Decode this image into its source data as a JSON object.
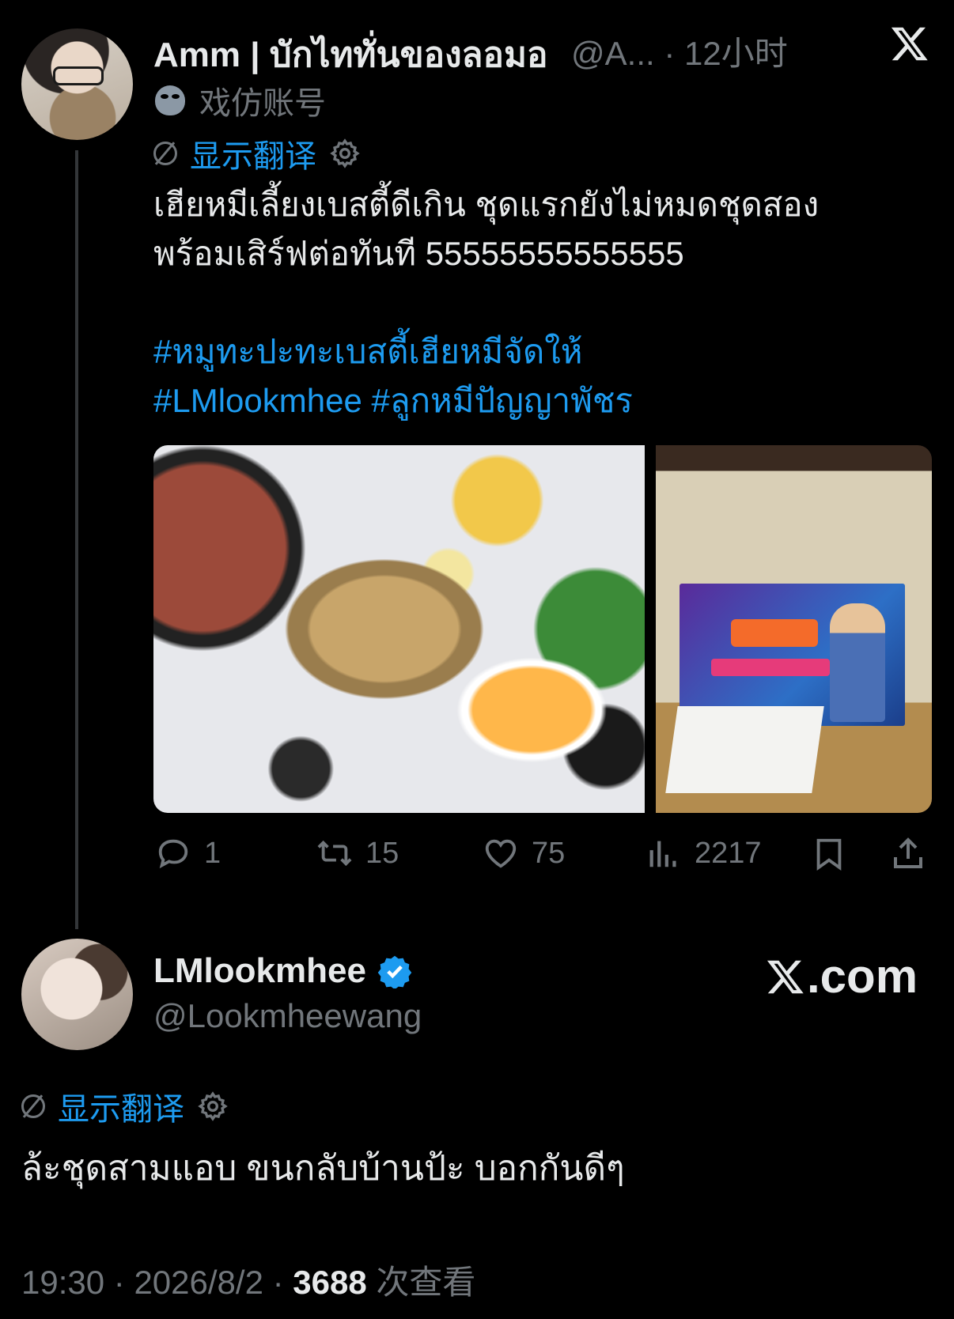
{
  "tweet": {
    "author_name": "Amm | บักไททั่นของลอมอ",
    "author_handle": "@A...",
    "separator": " · ",
    "time_ago": "12小时",
    "parody_label": "戏仿账号",
    "translate_label": "显示翻译",
    "text_line1": "เฮียหมีเลี้ยงเบสตี้ดีเกิน ชุดแรกยังไม่หมดชุดสอง",
    "text_line2": "พร้อมเสิร์ฟต่อทันที 55555555555555",
    "hashtag_line1": "#หมูทะปะทะเบสตี้เฮียหมีจัดให้",
    "hashtag_line2": "#LMlookmhee #ลูกหมีปัญญาพัชร",
    "stats": {
      "replies": "1",
      "retweets": "15",
      "likes": "75",
      "views": "2217"
    }
  },
  "reply": {
    "author_name": "LMlookmhee",
    "author_handle": "@Lookmheewang",
    "translate_label": "显示翻译",
    "text": "ล้ะชุดสามแอบ ขนกลับบ้านป้ะ บอกกันดีๆ",
    "time": "19:30",
    "date": "2026/8/2",
    "views_count": "3688",
    "views_label": "次查看",
    "separator": " · "
  },
  "watermark": {
    "site": ".com"
  },
  "colors": {
    "background": "#000000",
    "text": "#e7e9ea",
    "muted": "#71767b",
    "link": "#1d9bf0",
    "verified": "#1d9bf0"
  },
  "icons": [
    "x-logo-icon",
    "parody-mask-icon",
    "translate-off-icon",
    "gear-icon",
    "reply-icon",
    "retweet-icon",
    "like-icon",
    "views-icon",
    "bookmark-icon",
    "share-icon",
    "verified-badge-icon"
  ]
}
